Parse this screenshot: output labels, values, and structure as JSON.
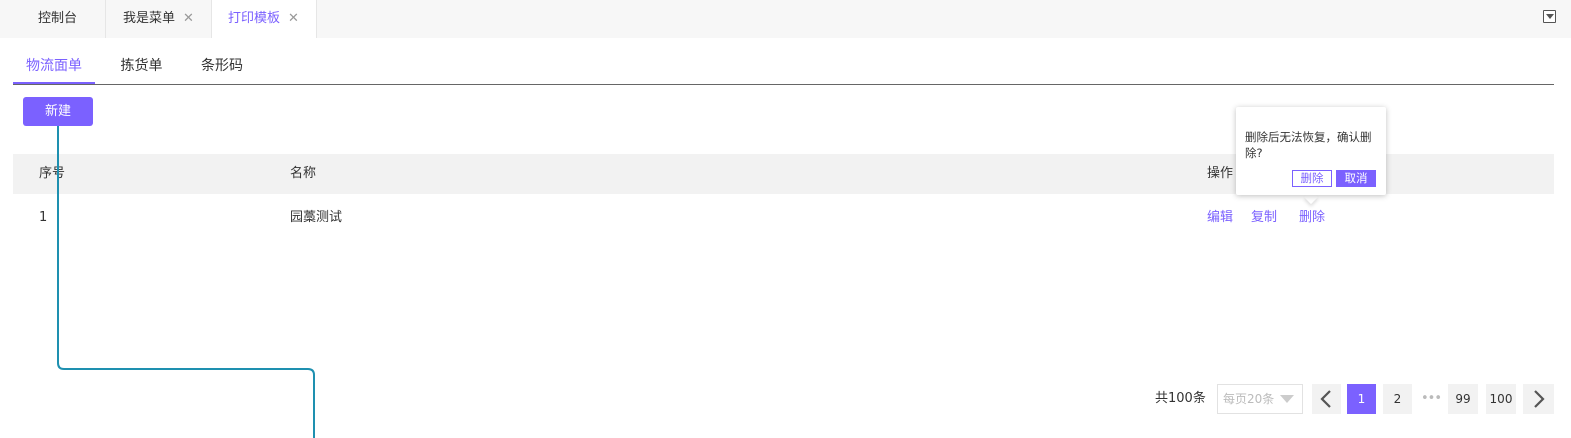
{
  "top_tabs": [
    {
      "label": "控制台"
    },
    {
      "label": "我是菜单",
      "close": "✕"
    },
    {
      "label": "打印模板",
      "close": "✕"
    }
  ],
  "sub_tabs": [
    {
      "label": "物流面单"
    },
    {
      "label": "拣货单"
    },
    {
      "label": "条形码"
    }
  ],
  "new_button": "新建",
  "table": {
    "headers": [
      "序号",
      "名称",
      "操作"
    ],
    "rows": [
      {
        "index": "1",
        "name": "园藁测试",
        "actions": [
          "编辑",
          "复制",
          "删除"
        ]
      }
    ]
  },
  "popconfirm": {
    "message": "删除后无法恢复，确认删除?",
    "confirm_label": "删除",
    "cancel_label": "取消"
  },
  "pagination": {
    "total": "共100条",
    "page_size": "每页20条",
    "prev_icon": "chevron-left-icon",
    "next_icon": "chevron-right-icon",
    "pages": [
      "1",
      "2",
      "99",
      "100"
    ],
    "ellipsis": "•••",
    "current": "1"
  },
  "colors": {
    "accent": "#7b61ff",
    "connector": "#1e90b0"
  }
}
